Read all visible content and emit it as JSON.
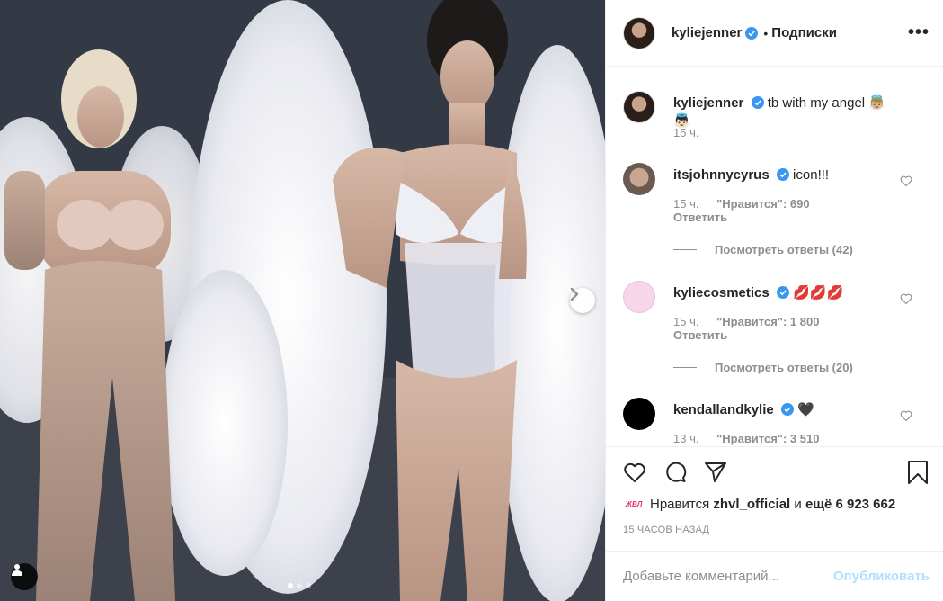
{
  "post": {
    "slide_count": 3,
    "active_slide": 1
  },
  "header": {
    "username": "kyliejenner",
    "separator": "•",
    "follow_label": "Подписки",
    "more_label": "•••"
  },
  "caption": {
    "username": "kyliejenner",
    "text": "tb with my angel 👼🏼👼🏻",
    "time": "15 ч."
  },
  "comments": [
    {
      "username": "itsjohnnycyrus",
      "text": "icon!!!",
      "time": "15 ч.",
      "likes": "\"Нравится\": 690",
      "reply_label": "Ответить",
      "view_replies": "Посмотреть ответы (42)"
    },
    {
      "username": "kyliecosmetics",
      "text": "💋💋💋",
      "time": "15 ч.",
      "likes": "\"Нравится\": 1 800",
      "reply_label": "Ответить",
      "view_replies": "Посмотреть ответы (20)"
    },
    {
      "username": "kendallandkylie",
      "text": "🖤",
      "time": "13 ч.",
      "likes": "\"Нравится\": 3 510"
    }
  ],
  "likes_row": {
    "prefix": "Нравится",
    "user": "zhvl_official",
    "conjunction": "и",
    "rest": "ещё 6 923 662",
    "mini_avatar_text": "ЖВЛ"
  },
  "time_ago": "15 ЧАСОВ НАЗАД",
  "add_comment": {
    "placeholder": "Добавьте комментарий...",
    "post_label": "Опубликовать"
  },
  "colors": {
    "verified": "#3897f0",
    "text": "#262626",
    "muted": "#8e8e8e",
    "post_disabled": "#b2dffc"
  }
}
